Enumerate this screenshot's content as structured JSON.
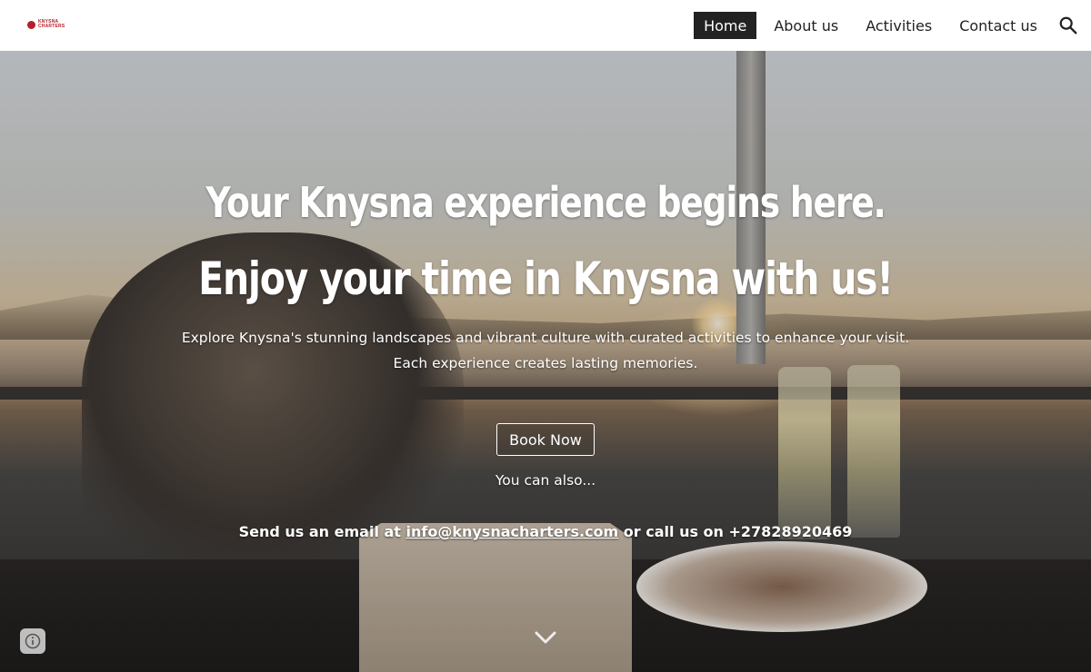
{
  "brand": {
    "logo_line1": "KNYSNA",
    "logo_line2": "CHARTERS",
    "color": "#b3202a"
  },
  "nav": {
    "items": [
      {
        "label": "Home",
        "active": true
      },
      {
        "label": "About us",
        "active": false
      },
      {
        "label": "Activities",
        "active": false
      },
      {
        "label": "Contact us",
        "active": false
      }
    ],
    "search_icon": "search-icon"
  },
  "hero": {
    "title_1": "Your Knysna experience begins here.",
    "title_2": "Enjoy your time in Knysna with us!",
    "description": "Explore Knysna's stunning landscapes and vibrant culture with curated activities to enhance your visit. Each experience creates lasting memories.",
    "book_button": "Book Now",
    "also_text": "You can also...",
    "contact_prefix": "Send us an email at ",
    "email": "info@knysnacharters.com",
    "contact_middle": " or call us on ",
    "phone": "+27828920469",
    "scroll_icon": "chevron-down-icon"
  },
  "info_icon": "info-icon"
}
